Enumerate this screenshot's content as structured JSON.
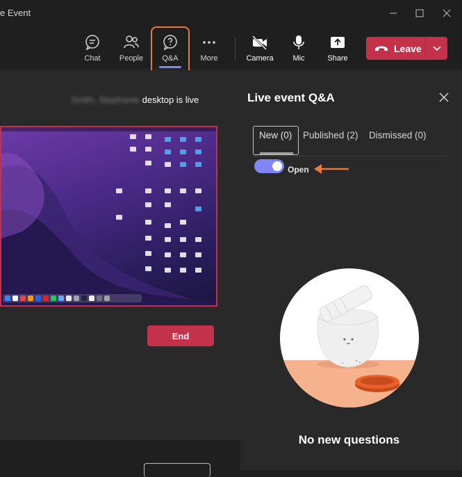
{
  "window": {
    "title": "e Event"
  },
  "toolbar": {
    "chat_label": "Chat",
    "people_label": "People",
    "qa_label": "Q&A",
    "more_label": "More",
    "camera_label": "Camera",
    "mic_label": "Mic",
    "share_label": "Share",
    "leave_label": "Leave"
  },
  "stage": {
    "presenter_name": "Smith, Stephanie",
    "live_status": "desktop is live",
    "end_label": "End"
  },
  "qa_panel": {
    "title": "Live event Q&A",
    "tabs": [
      {
        "label": "New (0)"
      },
      {
        "label": "Published (2)"
      },
      {
        "label": "Dismissed (0)"
      }
    ],
    "toggle_label": "Open",
    "empty_message": "No new questions"
  },
  "colors": {
    "accent": "#7f85f5",
    "leave": "#c4314b",
    "highlight": "#e8783a"
  }
}
